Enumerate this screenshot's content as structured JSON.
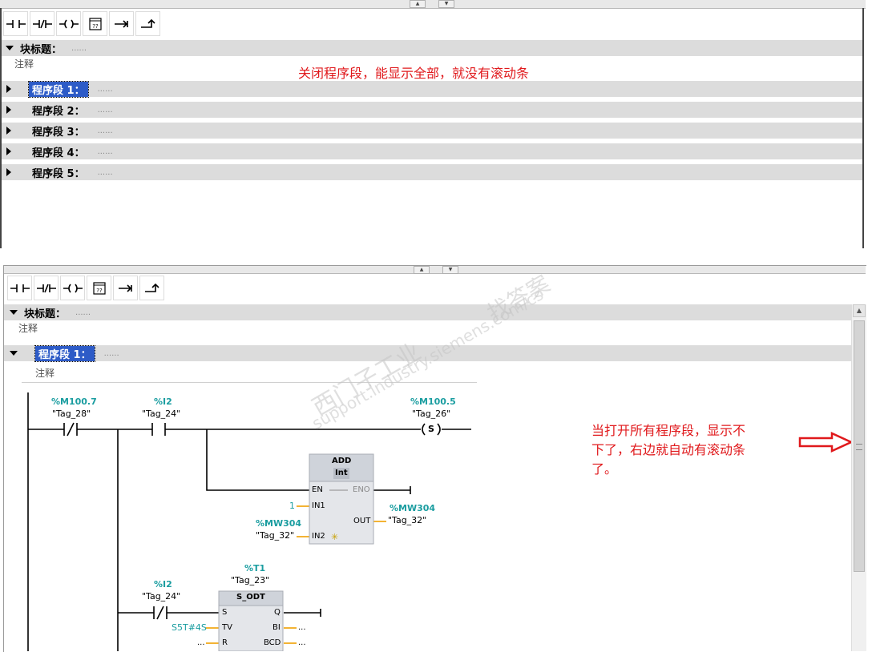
{
  "top_panel": {
    "block_title_label": "块标题：",
    "block_title_dots": "......",
    "block_comment": "注释",
    "annotation": "关闭程序段，能显示全部，就没有滚动条",
    "networks": [
      {
        "label": "程序段 1：",
        "dots": "......",
        "selected": true
      },
      {
        "label": "程序段 2：",
        "dots": "......",
        "selected": false
      },
      {
        "label": "程序段 3：",
        "dots": "......",
        "selected": false
      },
      {
        "label": "程序段 4：",
        "dots": "......",
        "selected": false
      },
      {
        "label": "程序段 5：",
        "dots": "......",
        "selected": false
      }
    ]
  },
  "toolbar": {
    "buttons": [
      {
        "name": "contact-no-icon"
      },
      {
        "name": "contact-nc-icon"
      },
      {
        "name": "coil-icon"
      },
      {
        "name": "empty-box-icon"
      },
      {
        "name": "open-branch-icon"
      },
      {
        "name": "close-branch-icon"
      }
    ],
    "empty_box_glyph": "??"
  },
  "bottom_panel": {
    "block_title_label": "块标题：",
    "block_title_dots": "......",
    "block_comment": "注释",
    "network1_label": "程序段 1：",
    "network1_dots": "......",
    "network1_comment": "注释",
    "annotation_line1": "当打开所有程序段，显示不",
    "annotation_line2": "下了，右边就自动有滚动条",
    "annotation_line3": "了。"
  },
  "ladder": {
    "contact1": {
      "operand": "%M100.7",
      "tag": "\"Tag_28\""
    },
    "contact2": {
      "operand": "%I2",
      "tag": "\"Tag_24\""
    },
    "coil": {
      "operand": "%M100.5",
      "tag": "\"Tag_26\"",
      "symbol": "S"
    },
    "add": {
      "title": "ADD",
      "type": "Int",
      "en": "EN",
      "eno": "ENO",
      "in1": "IN1",
      "in1_value": "1",
      "in2": "IN2",
      "in2_operand": "%MW304",
      "in2_tag": "\"Tag_32\"",
      "out": "OUT",
      "out_operand": "%MW304",
      "out_tag": "\"Tag_32\""
    },
    "contact3": {
      "operand": "%I2",
      "tag": "\"Tag_24\""
    },
    "timer": {
      "operand": "%T1",
      "tag": "\"Tag_23\"",
      "title": "S_ODT",
      "s": "S",
      "q": "Q",
      "tv": "TV",
      "tv_value": "S5T#4S",
      "bi": "BI",
      "bi_value": "...",
      "r": "R",
      "r_value": "...",
      "bcd": "BCD",
      "bcd_value": "..."
    }
  },
  "watermark": {
    "line1": "西门子工业",
    "line2": "support.industry.siemens.com/cs",
    "line3": "找答案"
  },
  "colors": {
    "operand": "#1a9da0",
    "annotation": "#e0191c",
    "selected": "#2d5bc7"
  }
}
